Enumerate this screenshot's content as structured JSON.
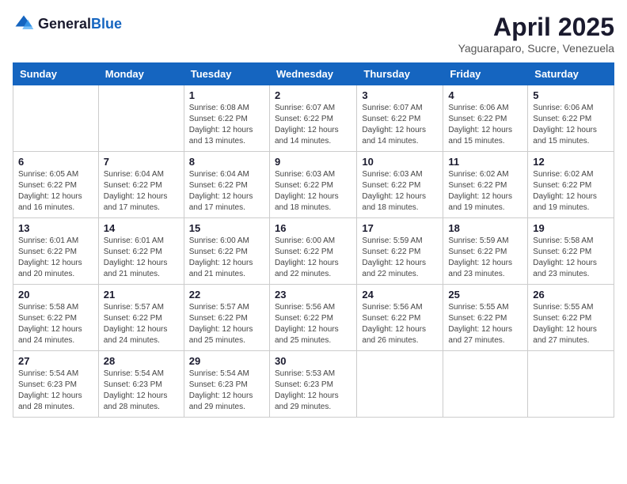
{
  "header": {
    "logo_general": "General",
    "logo_blue": "Blue",
    "month_title": "April 2025",
    "location": "Yaguaraparo, Sucre, Venezuela"
  },
  "weekdays": [
    "Sunday",
    "Monday",
    "Tuesday",
    "Wednesday",
    "Thursday",
    "Friday",
    "Saturday"
  ],
  "weeks": [
    [
      {
        "day": "",
        "info": ""
      },
      {
        "day": "",
        "info": ""
      },
      {
        "day": "1",
        "info": "Sunrise: 6:08 AM\nSunset: 6:22 PM\nDaylight: 12 hours and 13 minutes."
      },
      {
        "day": "2",
        "info": "Sunrise: 6:07 AM\nSunset: 6:22 PM\nDaylight: 12 hours and 14 minutes."
      },
      {
        "day": "3",
        "info": "Sunrise: 6:07 AM\nSunset: 6:22 PM\nDaylight: 12 hours and 14 minutes."
      },
      {
        "day": "4",
        "info": "Sunrise: 6:06 AM\nSunset: 6:22 PM\nDaylight: 12 hours and 15 minutes."
      },
      {
        "day": "5",
        "info": "Sunrise: 6:06 AM\nSunset: 6:22 PM\nDaylight: 12 hours and 15 minutes."
      }
    ],
    [
      {
        "day": "6",
        "info": "Sunrise: 6:05 AM\nSunset: 6:22 PM\nDaylight: 12 hours and 16 minutes."
      },
      {
        "day": "7",
        "info": "Sunrise: 6:04 AM\nSunset: 6:22 PM\nDaylight: 12 hours and 17 minutes."
      },
      {
        "day": "8",
        "info": "Sunrise: 6:04 AM\nSunset: 6:22 PM\nDaylight: 12 hours and 17 minutes."
      },
      {
        "day": "9",
        "info": "Sunrise: 6:03 AM\nSunset: 6:22 PM\nDaylight: 12 hours and 18 minutes."
      },
      {
        "day": "10",
        "info": "Sunrise: 6:03 AM\nSunset: 6:22 PM\nDaylight: 12 hours and 18 minutes."
      },
      {
        "day": "11",
        "info": "Sunrise: 6:02 AM\nSunset: 6:22 PM\nDaylight: 12 hours and 19 minutes."
      },
      {
        "day": "12",
        "info": "Sunrise: 6:02 AM\nSunset: 6:22 PM\nDaylight: 12 hours and 19 minutes."
      }
    ],
    [
      {
        "day": "13",
        "info": "Sunrise: 6:01 AM\nSunset: 6:22 PM\nDaylight: 12 hours and 20 minutes."
      },
      {
        "day": "14",
        "info": "Sunrise: 6:01 AM\nSunset: 6:22 PM\nDaylight: 12 hours and 21 minutes."
      },
      {
        "day": "15",
        "info": "Sunrise: 6:00 AM\nSunset: 6:22 PM\nDaylight: 12 hours and 21 minutes."
      },
      {
        "day": "16",
        "info": "Sunrise: 6:00 AM\nSunset: 6:22 PM\nDaylight: 12 hours and 22 minutes."
      },
      {
        "day": "17",
        "info": "Sunrise: 5:59 AM\nSunset: 6:22 PM\nDaylight: 12 hours and 22 minutes."
      },
      {
        "day": "18",
        "info": "Sunrise: 5:59 AM\nSunset: 6:22 PM\nDaylight: 12 hours and 23 minutes."
      },
      {
        "day": "19",
        "info": "Sunrise: 5:58 AM\nSunset: 6:22 PM\nDaylight: 12 hours and 23 minutes."
      }
    ],
    [
      {
        "day": "20",
        "info": "Sunrise: 5:58 AM\nSunset: 6:22 PM\nDaylight: 12 hours and 24 minutes."
      },
      {
        "day": "21",
        "info": "Sunrise: 5:57 AM\nSunset: 6:22 PM\nDaylight: 12 hours and 24 minutes."
      },
      {
        "day": "22",
        "info": "Sunrise: 5:57 AM\nSunset: 6:22 PM\nDaylight: 12 hours and 25 minutes."
      },
      {
        "day": "23",
        "info": "Sunrise: 5:56 AM\nSunset: 6:22 PM\nDaylight: 12 hours and 25 minutes."
      },
      {
        "day": "24",
        "info": "Sunrise: 5:56 AM\nSunset: 6:22 PM\nDaylight: 12 hours and 26 minutes."
      },
      {
        "day": "25",
        "info": "Sunrise: 5:55 AM\nSunset: 6:22 PM\nDaylight: 12 hours and 27 minutes."
      },
      {
        "day": "26",
        "info": "Sunrise: 5:55 AM\nSunset: 6:22 PM\nDaylight: 12 hours and 27 minutes."
      }
    ],
    [
      {
        "day": "27",
        "info": "Sunrise: 5:54 AM\nSunset: 6:23 PM\nDaylight: 12 hours and 28 minutes."
      },
      {
        "day": "28",
        "info": "Sunrise: 5:54 AM\nSunset: 6:23 PM\nDaylight: 12 hours and 28 minutes."
      },
      {
        "day": "29",
        "info": "Sunrise: 5:54 AM\nSunset: 6:23 PM\nDaylight: 12 hours and 29 minutes."
      },
      {
        "day": "30",
        "info": "Sunrise: 5:53 AM\nSunset: 6:23 PM\nDaylight: 12 hours and 29 minutes."
      },
      {
        "day": "",
        "info": ""
      },
      {
        "day": "",
        "info": ""
      },
      {
        "day": "",
        "info": ""
      }
    ]
  ]
}
